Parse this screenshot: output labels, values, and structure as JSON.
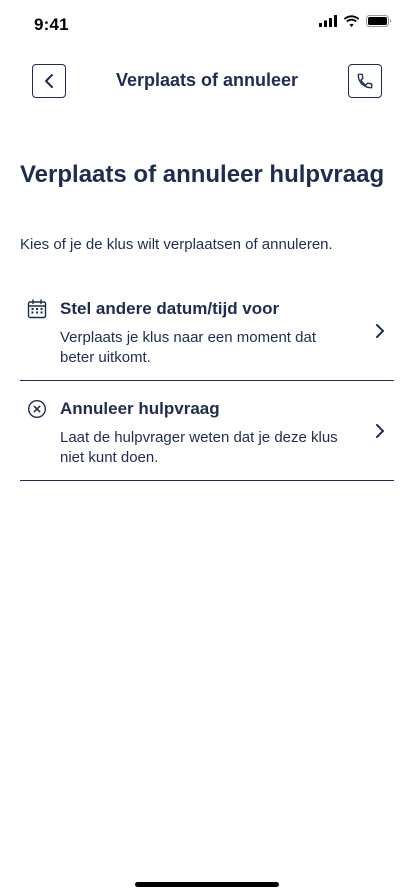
{
  "status_bar": {
    "time": "9:41"
  },
  "nav": {
    "title": "Verplaats of annuleer",
    "back_icon": "chevron-left-icon",
    "call_icon": "phone-icon"
  },
  "page": {
    "title": "Verplaats of annuleer hulpvraag",
    "subtitle": "Kies of je de klus wilt verplaatsen of annuleren."
  },
  "options": [
    {
      "icon": "calendar-icon",
      "title": "Stel andere datum/tijd voor",
      "description": "Verplaats je klus naar een moment dat beter uitkomt."
    },
    {
      "icon": "cancel-circle-icon",
      "title": "Annuleer hulpvraag",
      "description": "Laat de hulpvrager weten dat je deze klus niet kunt doen."
    }
  ],
  "colors": {
    "primary": "#1e2d4f",
    "background": "#ffffff"
  }
}
